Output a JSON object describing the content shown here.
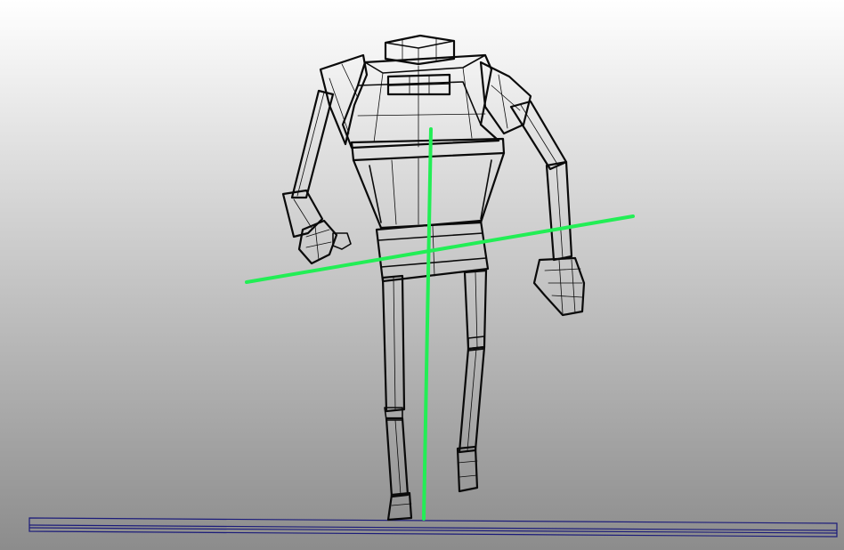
{
  "viewport": {
    "background_top": "#ffffff",
    "background_bottom": "#8c8c8c"
  },
  "model": {
    "wire_color": "#0a0a0a"
  },
  "gizmo": {
    "color": "#22ee55"
  },
  "ground_plane": {
    "color": "#1c1c7a"
  }
}
